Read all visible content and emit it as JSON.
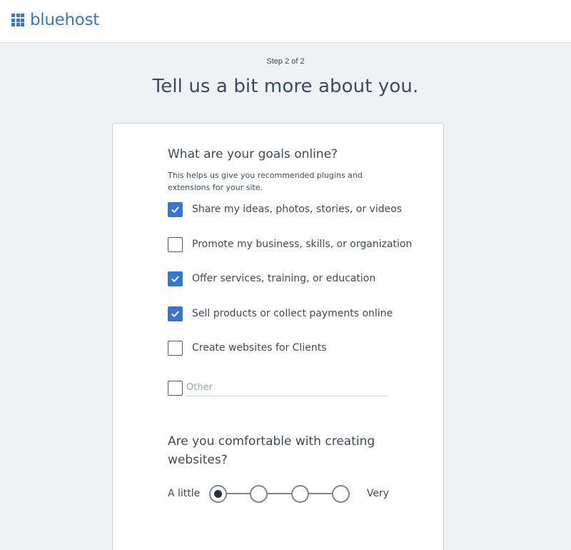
{
  "brand": {
    "name": "bluehost",
    "color": "#3575d3"
  },
  "header": {
    "step": "Step 2 of 2",
    "title": "Tell us a bit more about you."
  },
  "goals": {
    "question": "What are your goals online?",
    "helper": "This helps us give you recommended plugins and extensions for your site.",
    "options": [
      {
        "label": "Share my ideas, photos, stories, or videos",
        "checked": true
      },
      {
        "label": "Promote my business, skills, or organization",
        "checked": false
      },
      {
        "label": "Offer services, training, or education",
        "checked": true
      },
      {
        "label": "Sell products or collect payments online",
        "checked": true
      },
      {
        "label": "Create websites for Clients",
        "checked": false
      }
    ],
    "other": {
      "placeholder": "Other",
      "value": "",
      "checked": false
    }
  },
  "comfort": {
    "question": "Are you comfortable with creating websites?",
    "low_label": "A little",
    "high_label": "Very",
    "levels": 4,
    "selected_level": 1
  }
}
